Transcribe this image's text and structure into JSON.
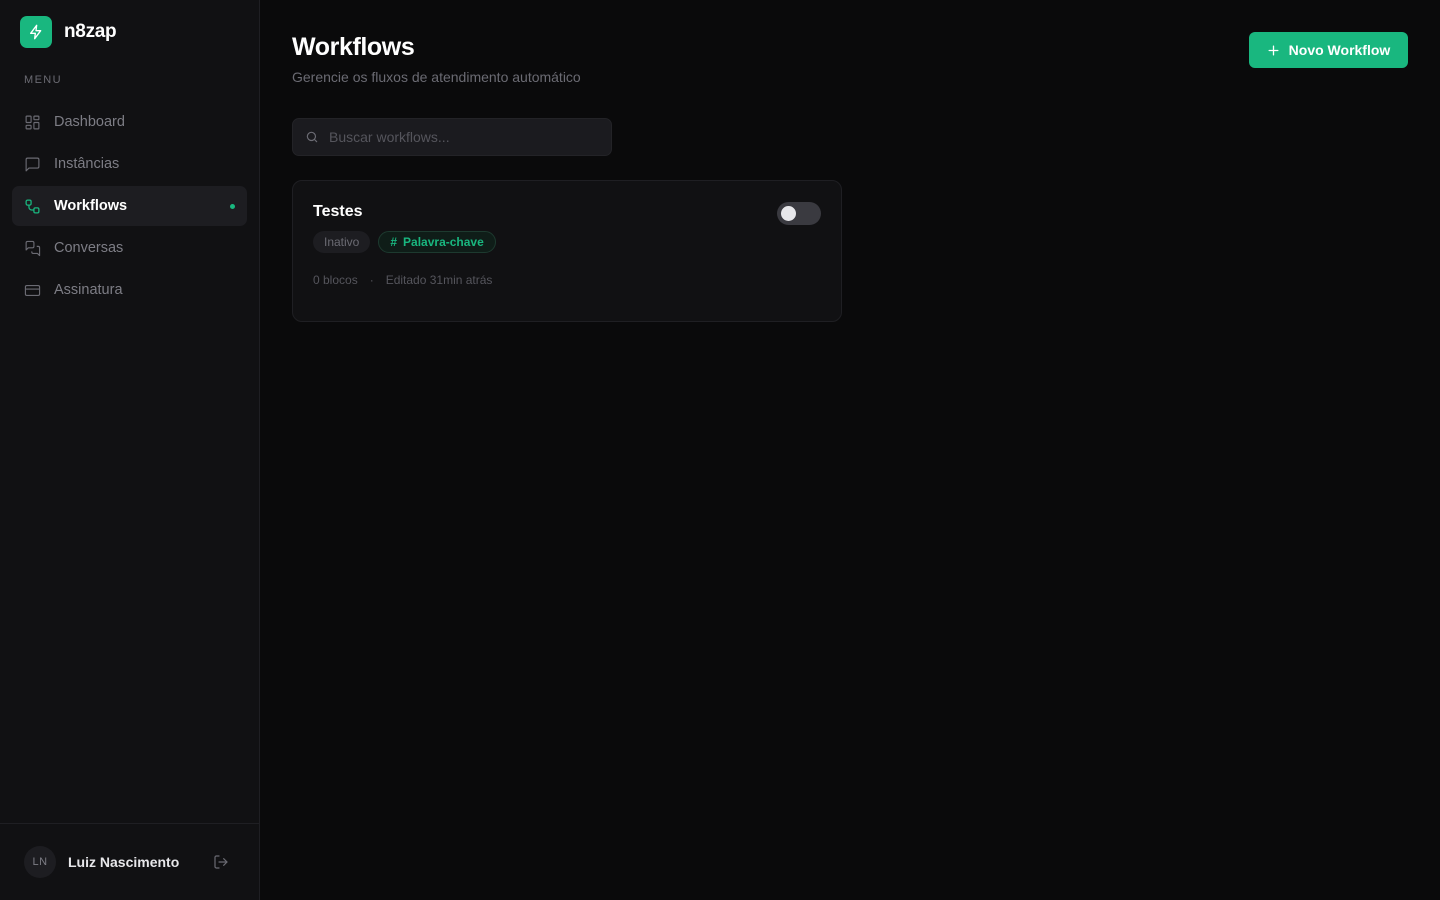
{
  "brand": {
    "name": "n8zap",
    "accent": "#19b77f"
  },
  "sidebar": {
    "menu_label": "MENU",
    "items": [
      {
        "label": "Dashboard",
        "icon": "layout-grid-icon",
        "active": false
      },
      {
        "label": "Instâncias",
        "icon": "message-square-icon",
        "active": false
      },
      {
        "label": "Workflows",
        "icon": "workflow-icon",
        "active": true
      },
      {
        "label": "Conversas",
        "icon": "messages-icon",
        "active": false
      },
      {
        "label": "Assinatura",
        "icon": "credit-card-icon",
        "active": false
      }
    ]
  },
  "user": {
    "initials": "LN",
    "name": "Luiz Nascimento"
  },
  "header": {
    "title": "Workflows",
    "subtitle": "Gerencie os fluxos de atendimento automático",
    "new_button_label": "Novo Workflow"
  },
  "search": {
    "placeholder": "Buscar workflows...",
    "value": ""
  },
  "workflows": [
    {
      "name": "Testes",
      "status": "Inativo",
      "trigger": "Palavra-chave",
      "enabled": false,
      "blocks": "0 blocos",
      "edited": "Editado 31min atrás"
    }
  ]
}
